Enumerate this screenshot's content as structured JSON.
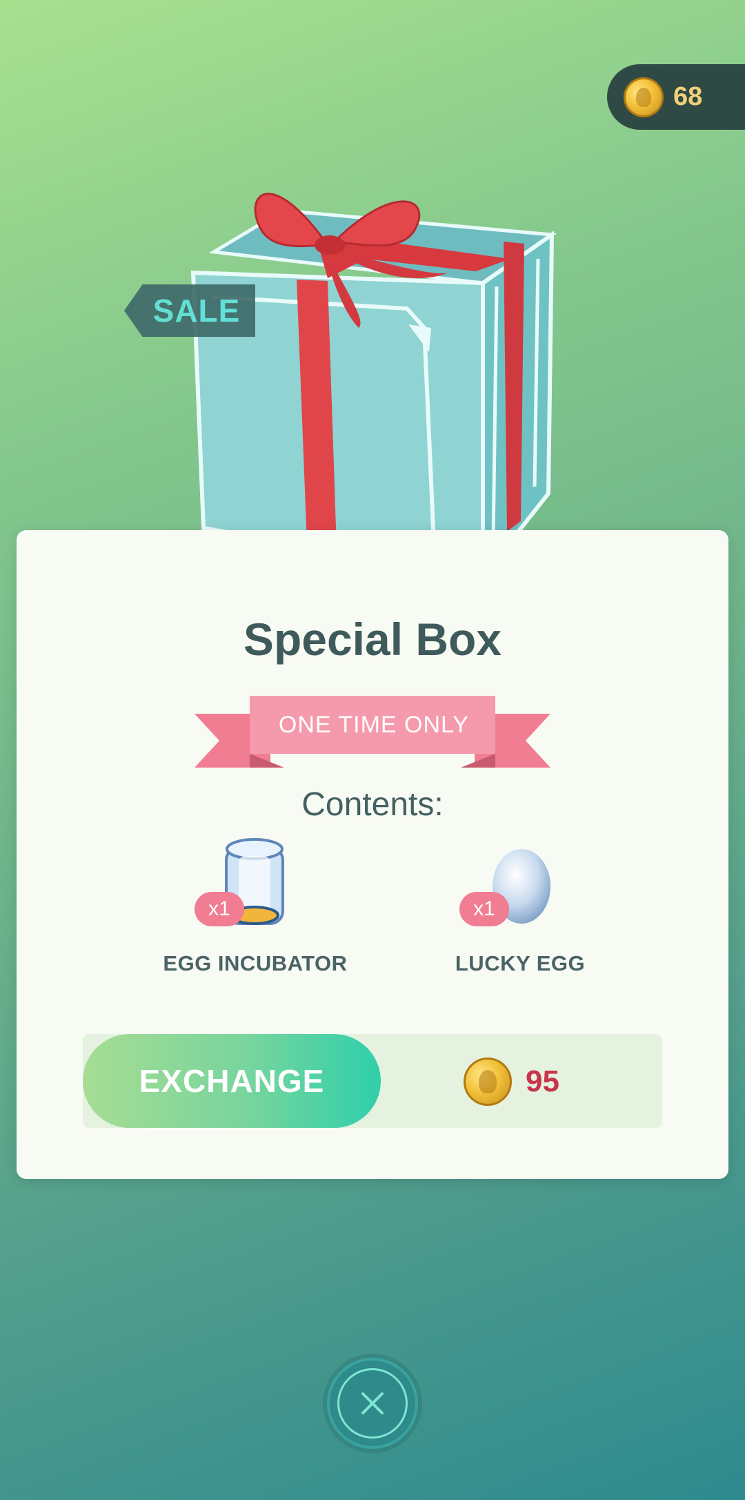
{
  "wallet": {
    "coins": "68",
    "icon": "pokecoin-icon"
  },
  "item": {
    "sale_label": "SALE",
    "name": "Special Box",
    "banner": "ONE TIME ONLY",
    "contents_label": "Contents:",
    "contents": [
      {
        "label": "EGG INCUBATOR",
        "quantity": "x1",
        "icon": "egg-incubator-icon"
      },
      {
        "label": "LUCKY EGG",
        "quantity": "x1",
        "icon": "lucky-egg-icon"
      }
    ]
  },
  "purchase": {
    "button_label": "EXCHANGE",
    "price": "95",
    "price_icon": "pokecoin-icon"
  },
  "close": {
    "icon": "close-icon"
  },
  "colors": {
    "accent": "#2fcfab",
    "price": "#c8344a",
    "banner": "#f07d92",
    "text": "#3f5a5b"
  }
}
